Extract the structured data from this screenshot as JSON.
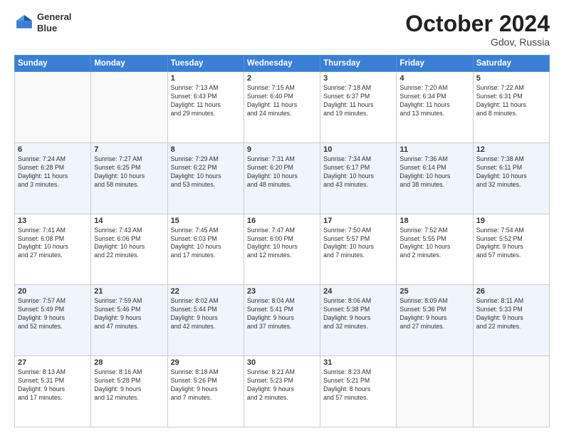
{
  "header": {
    "logo_line1": "General",
    "logo_line2": "Blue",
    "month_title": "October 2024",
    "location": "Gdov, Russia"
  },
  "days_of_week": [
    "Sunday",
    "Monday",
    "Tuesday",
    "Wednesday",
    "Thursday",
    "Friday",
    "Saturday"
  ],
  "weeks": [
    [
      {
        "num": "",
        "info": ""
      },
      {
        "num": "",
        "info": ""
      },
      {
        "num": "1",
        "info": "Sunrise: 7:13 AM\nSunset: 6:43 PM\nDaylight: 11 hours\nand 29 minutes."
      },
      {
        "num": "2",
        "info": "Sunrise: 7:15 AM\nSunset: 6:40 PM\nDaylight: 11 hours\nand 24 minutes."
      },
      {
        "num": "3",
        "info": "Sunrise: 7:18 AM\nSunset: 6:37 PM\nDaylight: 11 hours\nand 19 minutes."
      },
      {
        "num": "4",
        "info": "Sunrise: 7:20 AM\nSunset: 6:34 PM\nDaylight: 11 hours\nand 13 minutes."
      },
      {
        "num": "5",
        "info": "Sunrise: 7:22 AM\nSunset: 6:31 PM\nDaylight: 11 hours\nand 8 minutes."
      }
    ],
    [
      {
        "num": "6",
        "info": "Sunrise: 7:24 AM\nSunset: 6:28 PM\nDaylight: 11 hours\nand 3 minutes."
      },
      {
        "num": "7",
        "info": "Sunrise: 7:27 AM\nSunset: 6:25 PM\nDaylight: 10 hours\nand 58 minutes."
      },
      {
        "num": "8",
        "info": "Sunrise: 7:29 AM\nSunset: 6:22 PM\nDaylight: 10 hours\nand 53 minutes."
      },
      {
        "num": "9",
        "info": "Sunrise: 7:31 AM\nSunset: 6:20 PM\nDaylight: 10 hours\nand 48 minutes."
      },
      {
        "num": "10",
        "info": "Sunrise: 7:34 AM\nSunset: 6:17 PM\nDaylight: 10 hours\nand 43 minutes."
      },
      {
        "num": "11",
        "info": "Sunrise: 7:36 AM\nSunset: 6:14 PM\nDaylight: 10 hours\nand 38 minutes."
      },
      {
        "num": "12",
        "info": "Sunrise: 7:38 AM\nSunset: 6:11 PM\nDaylight: 10 hours\nand 32 minutes."
      }
    ],
    [
      {
        "num": "13",
        "info": "Sunrise: 7:41 AM\nSunset: 6:08 PM\nDaylight: 10 hours\nand 27 minutes."
      },
      {
        "num": "14",
        "info": "Sunrise: 7:43 AM\nSunset: 6:06 PM\nDaylight: 10 hours\nand 22 minutes."
      },
      {
        "num": "15",
        "info": "Sunrise: 7:45 AM\nSunset: 6:03 PM\nDaylight: 10 hours\nand 17 minutes."
      },
      {
        "num": "16",
        "info": "Sunrise: 7:47 AM\nSunset: 6:00 PM\nDaylight: 10 hours\nand 12 minutes."
      },
      {
        "num": "17",
        "info": "Sunrise: 7:50 AM\nSunset: 5:57 PM\nDaylight: 10 hours\nand 7 minutes."
      },
      {
        "num": "18",
        "info": "Sunrise: 7:52 AM\nSunset: 5:55 PM\nDaylight: 10 hours\nand 2 minutes."
      },
      {
        "num": "19",
        "info": "Sunrise: 7:54 AM\nSunset: 5:52 PM\nDaylight: 9 hours\nand 57 minutes."
      }
    ],
    [
      {
        "num": "20",
        "info": "Sunrise: 7:57 AM\nSunset: 5:49 PM\nDaylight: 9 hours\nand 52 minutes."
      },
      {
        "num": "21",
        "info": "Sunrise: 7:59 AM\nSunset: 5:46 PM\nDaylight: 9 hours\nand 47 minutes."
      },
      {
        "num": "22",
        "info": "Sunrise: 8:02 AM\nSunset: 5:44 PM\nDaylight: 9 hours\nand 42 minutes."
      },
      {
        "num": "23",
        "info": "Sunrise: 8:04 AM\nSunset: 5:41 PM\nDaylight: 9 hours\nand 37 minutes."
      },
      {
        "num": "24",
        "info": "Sunrise: 8:06 AM\nSunset: 5:38 PM\nDaylight: 9 hours\nand 32 minutes."
      },
      {
        "num": "25",
        "info": "Sunrise: 8:09 AM\nSunset: 5:36 PM\nDaylight: 9 hours\nand 27 minutes."
      },
      {
        "num": "26",
        "info": "Sunrise: 8:11 AM\nSunset: 5:33 PM\nDaylight: 9 hours\nand 22 minutes."
      }
    ],
    [
      {
        "num": "27",
        "info": "Sunrise: 8:13 AM\nSunset: 5:31 PM\nDaylight: 9 hours\nand 17 minutes."
      },
      {
        "num": "28",
        "info": "Sunrise: 8:16 AM\nSunset: 5:28 PM\nDaylight: 9 hours\nand 12 minutes."
      },
      {
        "num": "29",
        "info": "Sunrise: 8:18 AM\nSunset: 5:26 PM\nDaylight: 9 hours\nand 7 minutes."
      },
      {
        "num": "30",
        "info": "Sunrise: 8:21 AM\nSunset: 5:23 PM\nDaylight: 9 hours\nand 2 minutes."
      },
      {
        "num": "31",
        "info": "Sunrise: 8:23 AM\nSunset: 5:21 PM\nDaylight: 8 hours\nand 57 minutes."
      },
      {
        "num": "",
        "info": ""
      },
      {
        "num": "",
        "info": ""
      }
    ]
  ]
}
